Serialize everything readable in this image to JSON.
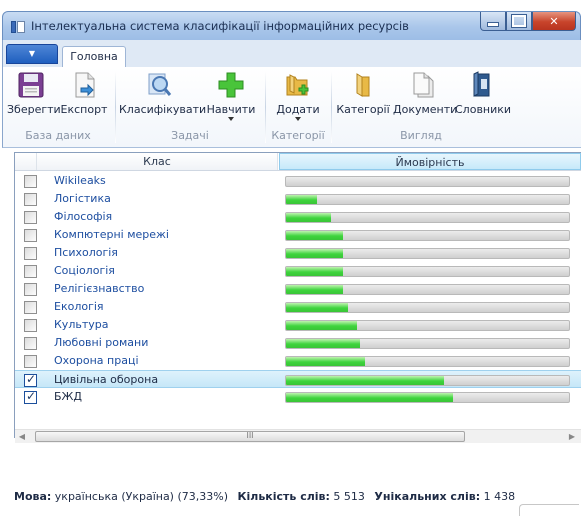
{
  "window": {
    "title": "Інтелектуальна система класифікації інформаційних ресурсів"
  },
  "tabs": {
    "home": "Головна"
  },
  "ribbon": {
    "groups": [
      {
        "label": "База даних",
        "buttons": [
          {
            "label": "Зберегти",
            "icon": "floppy-disk-icon"
          },
          {
            "label": "Експорт",
            "icon": "export-document-icon"
          }
        ]
      },
      {
        "label": "Задачі",
        "buttons": [
          {
            "label": "Класифікувати",
            "icon": "classify-magnifier-icon"
          },
          {
            "label": "Навчити",
            "icon": "green-plus-icon"
          }
        ]
      },
      {
        "label": "Категорії",
        "buttons": [
          {
            "label": "Додати",
            "icon": "add-folder-icon"
          }
        ]
      },
      {
        "label": "Вигляд",
        "buttons": [
          {
            "label": "Категорії",
            "icon": "categories-folder-icon"
          },
          {
            "label": "Документи",
            "icon": "documents-icon"
          },
          {
            "label": "Словники",
            "icon": "dictionary-book-icon"
          }
        ]
      }
    ]
  },
  "grid": {
    "columns": {
      "class": "Клас",
      "probability": "Ймовірність"
    },
    "rows": [
      {
        "label": "Wikileaks",
        "checked": false,
        "probability": 0
      },
      {
        "label": "Логістика",
        "checked": false,
        "probability": 0.11
      },
      {
        "label": "Філософія",
        "checked": false,
        "probability": 0.16
      },
      {
        "label": "Компютерні мережі",
        "checked": false,
        "probability": 0.2
      },
      {
        "label": "Психологія",
        "checked": false,
        "probability": 0.2
      },
      {
        "label": "Соціологія",
        "checked": false,
        "probability": 0.2
      },
      {
        "label": "Релігієзнавство",
        "checked": false,
        "probability": 0.2
      },
      {
        "label": "Екологія",
        "checked": false,
        "probability": 0.22
      },
      {
        "label": "Культура",
        "checked": false,
        "probability": 0.25
      },
      {
        "label": "Любовні романи",
        "checked": false,
        "probability": 0.26
      },
      {
        "label": "Охорона праці",
        "checked": false,
        "probability": 0.28
      },
      {
        "label": "Цивільна оборона",
        "checked": true,
        "probability": 0.56,
        "selected": true
      },
      {
        "label": "БЖД",
        "checked": true,
        "probability": 0.59
      }
    ]
  },
  "scrollbar": {
    "thumb_text": "III"
  },
  "status": {
    "language_label": "Мова:",
    "language_value": "українська (Україна) (73,33%)",
    "words_label": "Кількість слів:",
    "words_value": "5 513",
    "unique_label": "Унікальних слів:",
    "unique_value": "1 438"
  },
  "colors": {
    "bar_fill": "#3fd43d",
    "selection": "#c6e7f8",
    "close_button": "#c8442b"
  }
}
